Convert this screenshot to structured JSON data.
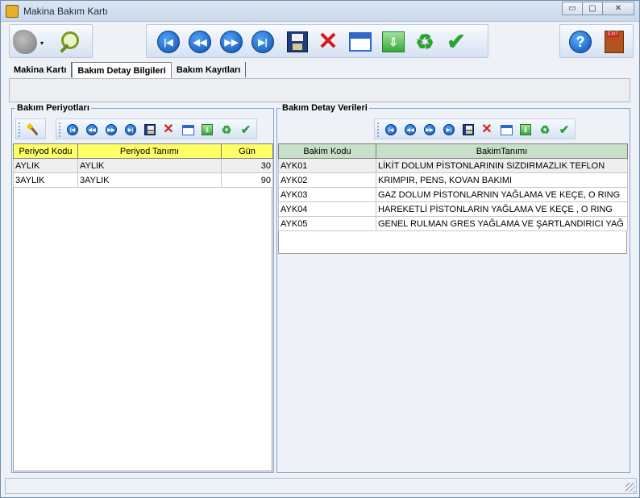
{
  "window": {
    "title": "Makina Bakım Kartı",
    "buttons": {
      "minimize": "▭",
      "maximize": "▢",
      "close": "✕"
    }
  },
  "main_toolbar": {
    "icons": [
      "gray-blob-icon",
      "magnifier-icon",
      "first-record-icon",
      "previous-record-icon",
      "next-record-icon",
      "last-record-icon",
      "save-icon",
      "delete-icon",
      "calendar-icon",
      "export-icon",
      "refresh-icon",
      "confirm-icon",
      "help-icon",
      "exit-icon"
    ]
  },
  "tabs": [
    {
      "label": "Makina Kartı"
    },
    {
      "label": "Bakım Detay Bilgileri"
    },
    {
      "label": "Bakım Kayıtları"
    }
  ],
  "left_panel": {
    "title": "Bakım Periyotları",
    "columns": [
      "Periyod Kodu",
      "Periyod Tanımı",
      "Gün"
    ],
    "rows": [
      [
        "AYLIK",
        "AYLIK",
        "30"
      ],
      [
        "3AYLIK",
        "3AYLIK",
        "90"
      ]
    ]
  },
  "right_panel": {
    "title": "Bakım Detay Verileri",
    "columns": [
      "Bakim Kodu",
      "BakimTanımı"
    ],
    "rows": [
      [
        "AYK01",
        "LİKİT DOLUM PİSTONLARININ SIZDIRMAZLIK TEFLON"
      ],
      [
        "AYK02",
        "KRIMPIR, PENS, KOVAN BAKIMI"
      ],
      [
        "AYK03",
        "GAZ DOLUM PİSTONLARNIN YAĞLAMA VE KEÇE, O RING"
      ],
      [
        "AYK04",
        "HAREKETLİ PİSTONLARIN YAĞLAMA VE KEÇE , O RING"
      ],
      [
        "AYK05",
        "GENEL RULMAN GRES YAĞLAMA VE ŞARTLANDIRICI YAĞ"
      ]
    ]
  },
  "colors": {
    "left_header": "#ffff66",
    "right_header": "#c8dfc8",
    "panel_border": "#7fa6cf"
  }
}
